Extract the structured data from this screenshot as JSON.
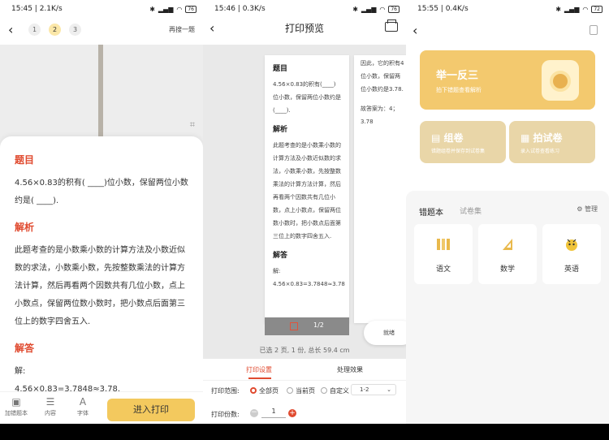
{
  "panel1": {
    "status": {
      "time": "15:45",
      "speed": "2.1K/s",
      "battery": "76"
    },
    "question_tabs": [
      "1",
      "2",
      "3"
    ],
    "search_again": "再搜一题",
    "title_question": "题目",
    "question": "4.56×0.83的积有( ____)位小数，保留两位小数约是( ____).",
    "title_analysis": "解析",
    "analysis": "此题考查的是小数乘小数的计算方法及小数近似数的求法，小数乘小数，先按整数乘法的计算方法计算，然后再看两个因数共有几位小数，点上小数点，保留两位数小数时，把小数点后面第三位上的数字四舍五入.",
    "title_answer": "解答",
    "answer_l1": "解:",
    "answer_l2": "4.56×0.83=3.7848≈3.78.",
    "toolbar": {
      "add_wrong": "加错题本",
      "content": "内容",
      "font": "字体",
      "print": "进入打印"
    }
  },
  "panel2": {
    "status": {
      "time": "15:46",
      "speed": "0.3K/s",
      "battery": "76"
    },
    "title": "打印预览",
    "page1": {
      "h_question": "题目",
      "question": "4.56×0.83的积有(____)位小数，保留两位小数约是(____).",
      "h_analysis": "解析",
      "analysis": "此题考查的是小数乘小数的计算方法及小数近似数的求法，小数乘小数，先按整数乘法的计算方法计算，然后再看两个因数共有几位小数，点上小数点，保留两位数小数时，把小数点后面第三位上的数字四舍五入.",
      "h_answer": "解答",
      "answer1": "解:",
      "answer2": "4.56×0.83=3.7848≈3.78"
    },
    "page2": {
      "text": "因此，它的积有4位小数，保留两位小数约是3.78.",
      "final": "故答案为：4；3.78"
    },
    "pager": "1/2",
    "done": "就绪",
    "summary": "已选 2 页, 1 份, 总长 59.4 cm",
    "tabs": {
      "settings": "打印设置",
      "effect": "处理效果"
    },
    "range_label": "打印范围:",
    "range_options": [
      "全部页",
      "当前页",
      "自定义"
    ],
    "range_value": "1-2",
    "copies_label": "打印份数:",
    "copies_value": "1"
  },
  "panel3": {
    "status": {
      "time": "15:55",
      "speed": "0.4K/s",
      "battery": "72"
    },
    "big_card": {
      "title": "举一反三",
      "sub": "拍下错题查看解析"
    },
    "card_group": {
      "title": "组卷",
      "sub": "错题组卷并保存到试卷集"
    },
    "card_photo": {
      "title": "拍试卷",
      "sub": "录入试卷查看练习"
    },
    "tab_wrong": "错题本",
    "tab_papers": "试卷集",
    "manage": "管理",
    "subjects": [
      "语文",
      "数学",
      "英语"
    ]
  }
}
